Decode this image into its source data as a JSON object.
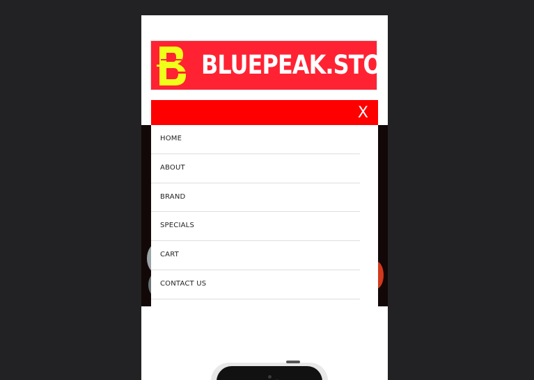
{
  "logo": {
    "brand_name": "BLUEPEAK.STORE",
    "mark_letter": "B",
    "mark_color": "#f0ff1a",
    "banner_color": "#ff2233"
  },
  "menu": {
    "bar_color": "#ff0000",
    "close_label": "X",
    "items": [
      {
        "label": "HOME"
      },
      {
        "label": "ABOUT"
      },
      {
        "label": "BRAND"
      },
      {
        "label": "SPECIALS"
      },
      {
        "label": "CART"
      },
      {
        "label": "CONTACT US"
      }
    ]
  },
  "icons": {
    "close": "close-icon",
    "logo": "logo-mark-icon"
  }
}
